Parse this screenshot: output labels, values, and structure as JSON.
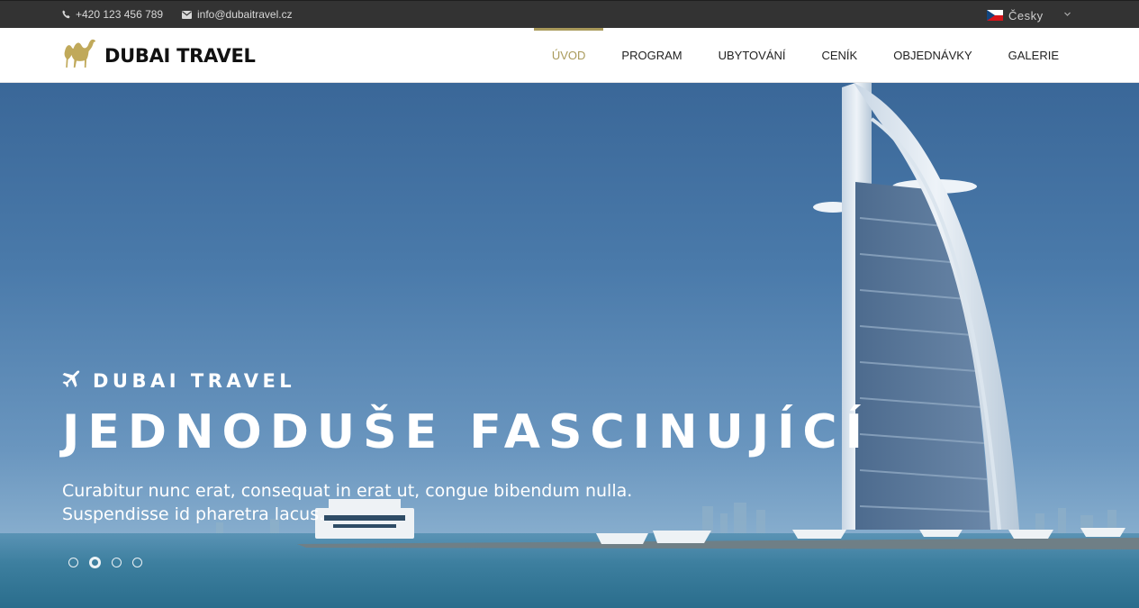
{
  "topbar": {
    "phone": "+420 123 456 789",
    "email": "info@dubaitravel.cz",
    "language": "Česky",
    "icons": {
      "phone": "phone-icon",
      "email": "envelope-icon",
      "flag": "czech-flag-icon",
      "dropdown": "chevron-down-icon"
    }
  },
  "header": {
    "logo_text": "DUBAI TRAVEL",
    "logo_icon": "camel-icon",
    "nav": [
      {
        "label": "ÚVOD",
        "active": true
      },
      {
        "label": "PROGRAM",
        "active": false
      },
      {
        "label": "UBYTOVÁNÍ",
        "active": false
      },
      {
        "label": "CENÍK",
        "active": false
      },
      {
        "label": "OBJEDNÁVKY",
        "active": false
      },
      {
        "label": "GALERIE",
        "active": false
      }
    ]
  },
  "hero": {
    "kicker": "DUBAI TRAVEL",
    "kicker_icon": "plane-icon",
    "headline": "JEDNODUŠE FASCINUJÍCÍ",
    "lead": "Curabitur nunc erat, consequat in erat ut, congue bibendum nulla. Suspendisse id pharetra lacus.",
    "slides": 4,
    "active_slide": 2
  },
  "colors": {
    "accent": "#a99a5b",
    "topbar": "#333333",
    "text": "#222222"
  }
}
